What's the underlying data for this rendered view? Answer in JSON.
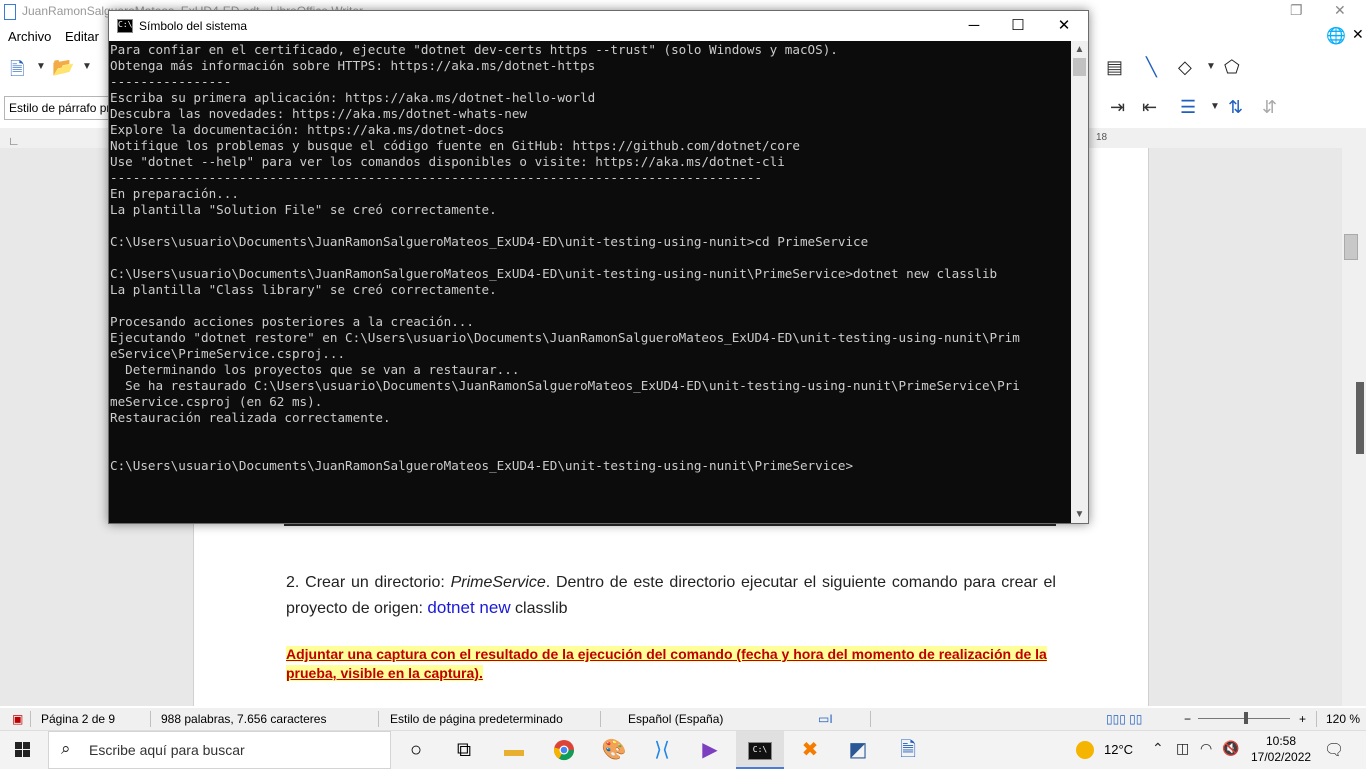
{
  "writer": {
    "title": "JuanRamonSalgueroMateos_ExUD4-ED.odt - LibreOffice Writer",
    "menu": [
      "Archivo",
      "Editar"
    ],
    "paragraph_style": "Estilo de párrafo pre",
    "ruler_number": "18",
    "paragraph1": {
      "prefix": "2. Crear un directorio: ",
      "dir_name": "PrimeService",
      "middle": ". Dentro de este directorio ejecutar el siguiente comando para crear el proyecto de origen: ",
      "command": "dotnet new",
      "suffix": " classlib"
    },
    "paragraph2": "Adjuntar una captura con el resultado de la ejecución del comando (fecha y hora del momento de realización de la prueba, visible en la captura).",
    "status": {
      "page": "Página 2 de 9",
      "words": "988 palabras, 7.656 caracteres",
      "page_style": "Estilo de página predeterminado",
      "language": "Español (España)",
      "zoom": "120 %"
    }
  },
  "cmd": {
    "title": "Símbolo del sistema",
    "icon_text": "C:\\",
    "minimize": "─",
    "maximize": "☐",
    "close": "✕",
    "lines": [
      "Para confiar en el certificado, ejecute \"dotnet dev-certs https --trust\" (solo Windows y macOS).",
      "Obtenga más información sobre HTTPS: https://aka.ms/dotnet-https",
      "----------------",
      "Escriba su primera aplicación: https://aka.ms/dotnet-hello-world",
      "Descubra las novedades: https://aka.ms/dotnet-whats-new",
      "Explore la documentación: https://aka.ms/dotnet-docs",
      "Notifique los problemas y busque el código fuente en GitHub: https://github.com/dotnet/core",
      "Use \"dotnet --help\" para ver los comandos disponibles o visite: https://aka.ms/dotnet-cli",
      "--------------------------------------------------------------------------------------",
      "En preparación...",
      "La plantilla \"Solution File\" se creó correctamente.",
      "",
      "C:\\Users\\usuario\\Documents\\JuanRamonSalgueroMateos_ExUD4-ED\\unit-testing-using-nunit>cd PrimeService",
      "",
      "C:\\Users\\usuario\\Documents\\JuanRamonSalgueroMateos_ExUD4-ED\\unit-testing-using-nunit\\PrimeService>dotnet new classlib",
      "La plantilla \"Class library\" se creó correctamente.",
      "",
      "Procesando acciones posteriores a la creación...",
      "Ejecutando \"dotnet restore\" en C:\\Users\\usuario\\Documents\\JuanRamonSalgueroMateos_ExUD4-ED\\unit-testing-using-nunit\\Prim",
      "eService\\PrimeService.csproj...",
      "  Determinando los proyectos que se van a restaurar...",
      "  Se ha restaurado C:\\Users\\usuario\\Documents\\JuanRamonSalgueroMateos_ExUD4-ED\\unit-testing-using-nunit\\PrimeService\\Pri",
      "meService.csproj (en 62 ms).",
      "Restauración realizada correctamente.",
      "",
      "",
      "C:\\Users\\usuario\\Documents\\JuanRamonSalgueroMateos_ExUD4-ED\\unit-testing-using-nunit\\PrimeService>"
    ]
  },
  "taskbar": {
    "search_placeholder": "Escribe aquí para buscar",
    "temperature": "12°C",
    "time": "10:58",
    "date": "17/02/2022",
    "apps": [
      "task-view",
      "file-explorer",
      "chrome",
      "paint",
      "vscode",
      "visual-studio",
      "command-prompt",
      "xampp",
      "network-tool",
      "libreoffice-writer"
    ]
  },
  "colors": {
    "console_bg": "#0c0c0c",
    "console_fg": "#cccccc",
    "warning_text": "#c00000",
    "highlight": "#ffff99",
    "command_blue": "#1a1ad6"
  }
}
